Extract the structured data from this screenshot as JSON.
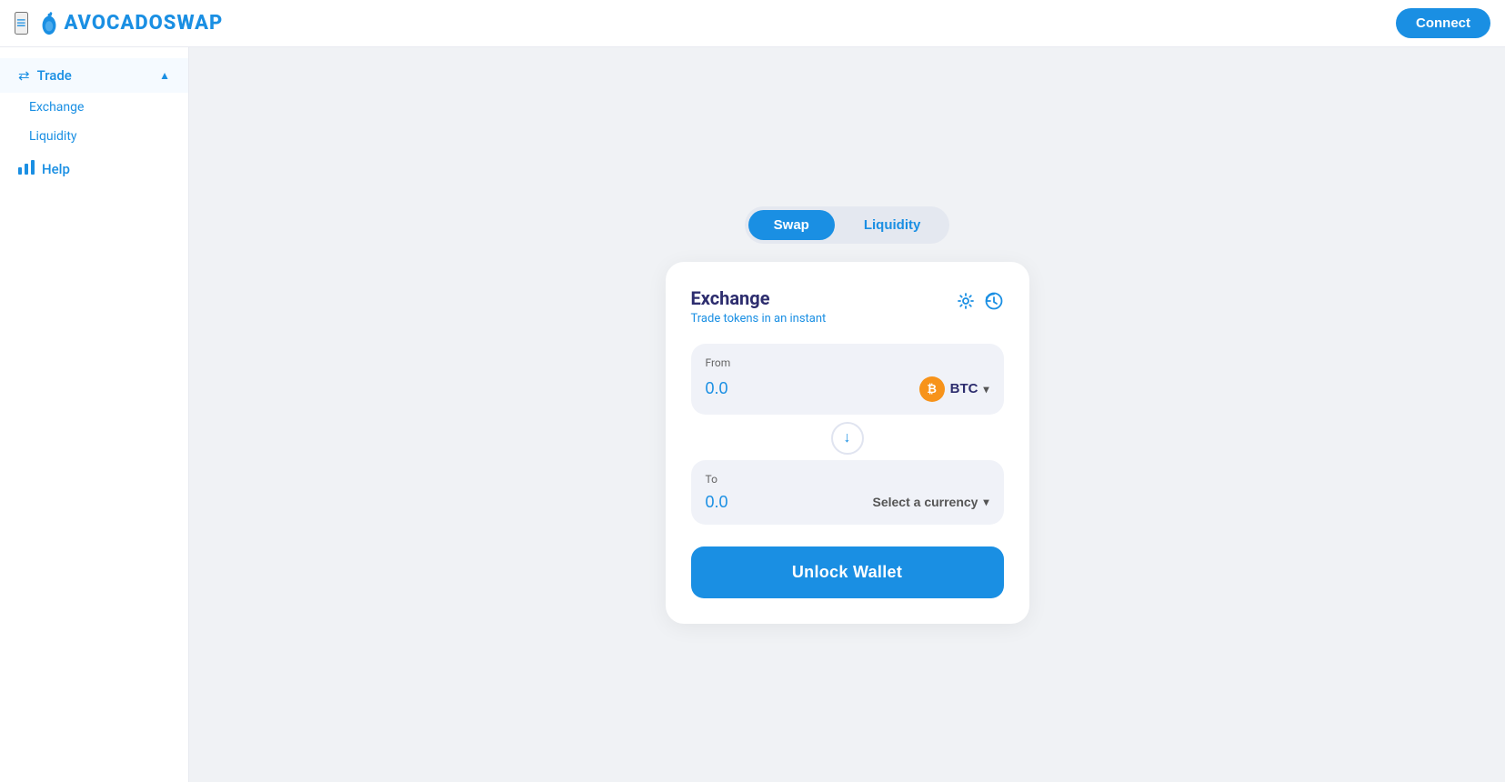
{
  "header": {
    "logo_text": "AVOCADOSWAP",
    "connect_label": "Connect"
  },
  "sidebar": {
    "menu_icon": "≡",
    "items": [
      {
        "id": "trade",
        "label": "Trade",
        "icon": "⇄",
        "active": true,
        "has_arrow": true
      },
      {
        "id": "exchange",
        "label": "Exchange",
        "sub": true
      },
      {
        "id": "liquidity",
        "label": "Liquidity",
        "sub": true
      },
      {
        "id": "help",
        "label": "Help",
        "icon": "📊",
        "active": false,
        "has_arrow": false
      }
    ]
  },
  "tabs": [
    {
      "id": "swap",
      "label": "Swap",
      "active": true
    },
    {
      "id": "liquidity",
      "label": "Liquidity",
      "active": false
    }
  ],
  "exchange_card": {
    "title": "Exchange",
    "subtitle": "Trade tokens in an instant",
    "settings_icon": "⚙",
    "history_icon": "🕐",
    "from_label": "From",
    "from_amount": "0.0",
    "from_token": "BTC",
    "to_label": "To",
    "to_amount": "0.0",
    "to_placeholder": "Select a currency",
    "swap_arrow": "↓",
    "unlock_label": "Unlock Wallet"
  },
  "colors": {
    "primary": "#1a8fe3",
    "title": "#2d2d6e",
    "btc_bg": "#f7931a"
  }
}
